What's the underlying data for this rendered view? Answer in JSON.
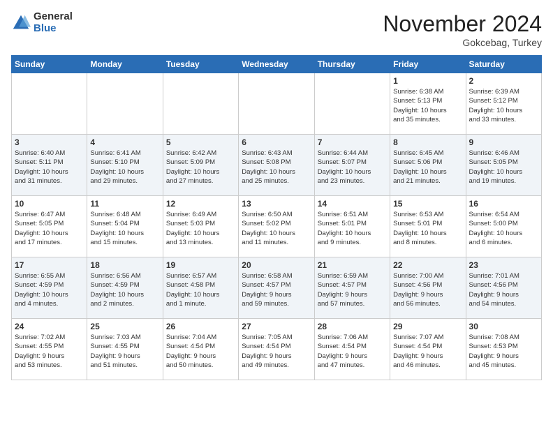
{
  "logo": {
    "general": "General",
    "blue": "Blue"
  },
  "header": {
    "month": "November 2024",
    "location": "Gokcebag, Turkey"
  },
  "weekdays": [
    "Sunday",
    "Monday",
    "Tuesday",
    "Wednesday",
    "Thursday",
    "Friday",
    "Saturday"
  ],
  "weeks": [
    [
      {
        "day": "",
        "info": ""
      },
      {
        "day": "",
        "info": ""
      },
      {
        "day": "",
        "info": ""
      },
      {
        "day": "",
        "info": ""
      },
      {
        "day": "",
        "info": ""
      },
      {
        "day": "1",
        "info": "Sunrise: 6:38 AM\nSunset: 5:13 PM\nDaylight: 10 hours\nand 35 minutes."
      },
      {
        "day": "2",
        "info": "Sunrise: 6:39 AM\nSunset: 5:12 PM\nDaylight: 10 hours\nand 33 minutes."
      }
    ],
    [
      {
        "day": "3",
        "info": "Sunrise: 6:40 AM\nSunset: 5:11 PM\nDaylight: 10 hours\nand 31 minutes."
      },
      {
        "day": "4",
        "info": "Sunrise: 6:41 AM\nSunset: 5:10 PM\nDaylight: 10 hours\nand 29 minutes."
      },
      {
        "day": "5",
        "info": "Sunrise: 6:42 AM\nSunset: 5:09 PM\nDaylight: 10 hours\nand 27 minutes."
      },
      {
        "day": "6",
        "info": "Sunrise: 6:43 AM\nSunset: 5:08 PM\nDaylight: 10 hours\nand 25 minutes."
      },
      {
        "day": "7",
        "info": "Sunrise: 6:44 AM\nSunset: 5:07 PM\nDaylight: 10 hours\nand 23 minutes."
      },
      {
        "day": "8",
        "info": "Sunrise: 6:45 AM\nSunset: 5:06 PM\nDaylight: 10 hours\nand 21 minutes."
      },
      {
        "day": "9",
        "info": "Sunrise: 6:46 AM\nSunset: 5:05 PM\nDaylight: 10 hours\nand 19 minutes."
      }
    ],
    [
      {
        "day": "10",
        "info": "Sunrise: 6:47 AM\nSunset: 5:05 PM\nDaylight: 10 hours\nand 17 minutes."
      },
      {
        "day": "11",
        "info": "Sunrise: 6:48 AM\nSunset: 5:04 PM\nDaylight: 10 hours\nand 15 minutes."
      },
      {
        "day": "12",
        "info": "Sunrise: 6:49 AM\nSunset: 5:03 PM\nDaylight: 10 hours\nand 13 minutes."
      },
      {
        "day": "13",
        "info": "Sunrise: 6:50 AM\nSunset: 5:02 PM\nDaylight: 10 hours\nand 11 minutes."
      },
      {
        "day": "14",
        "info": "Sunrise: 6:51 AM\nSunset: 5:01 PM\nDaylight: 10 hours\nand 9 minutes."
      },
      {
        "day": "15",
        "info": "Sunrise: 6:53 AM\nSunset: 5:01 PM\nDaylight: 10 hours\nand 8 minutes."
      },
      {
        "day": "16",
        "info": "Sunrise: 6:54 AM\nSunset: 5:00 PM\nDaylight: 10 hours\nand 6 minutes."
      }
    ],
    [
      {
        "day": "17",
        "info": "Sunrise: 6:55 AM\nSunset: 4:59 PM\nDaylight: 10 hours\nand 4 minutes."
      },
      {
        "day": "18",
        "info": "Sunrise: 6:56 AM\nSunset: 4:59 PM\nDaylight: 10 hours\nand 2 minutes."
      },
      {
        "day": "19",
        "info": "Sunrise: 6:57 AM\nSunset: 4:58 PM\nDaylight: 10 hours\nand 1 minute."
      },
      {
        "day": "20",
        "info": "Sunrise: 6:58 AM\nSunset: 4:57 PM\nDaylight: 9 hours\nand 59 minutes."
      },
      {
        "day": "21",
        "info": "Sunrise: 6:59 AM\nSunset: 4:57 PM\nDaylight: 9 hours\nand 57 minutes."
      },
      {
        "day": "22",
        "info": "Sunrise: 7:00 AM\nSunset: 4:56 PM\nDaylight: 9 hours\nand 56 minutes."
      },
      {
        "day": "23",
        "info": "Sunrise: 7:01 AM\nSunset: 4:56 PM\nDaylight: 9 hours\nand 54 minutes."
      }
    ],
    [
      {
        "day": "24",
        "info": "Sunrise: 7:02 AM\nSunset: 4:55 PM\nDaylight: 9 hours\nand 53 minutes."
      },
      {
        "day": "25",
        "info": "Sunrise: 7:03 AM\nSunset: 4:55 PM\nDaylight: 9 hours\nand 51 minutes."
      },
      {
        "day": "26",
        "info": "Sunrise: 7:04 AM\nSunset: 4:54 PM\nDaylight: 9 hours\nand 50 minutes."
      },
      {
        "day": "27",
        "info": "Sunrise: 7:05 AM\nSunset: 4:54 PM\nDaylight: 9 hours\nand 49 minutes."
      },
      {
        "day": "28",
        "info": "Sunrise: 7:06 AM\nSunset: 4:54 PM\nDaylight: 9 hours\nand 47 minutes."
      },
      {
        "day": "29",
        "info": "Sunrise: 7:07 AM\nSunset: 4:54 PM\nDaylight: 9 hours\nand 46 minutes."
      },
      {
        "day": "30",
        "info": "Sunrise: 7:08 AM\nSunset: 4:53 PM\nDaylight: 9 hours\nand 45 minutes."
      }
    ]
  ]
}
